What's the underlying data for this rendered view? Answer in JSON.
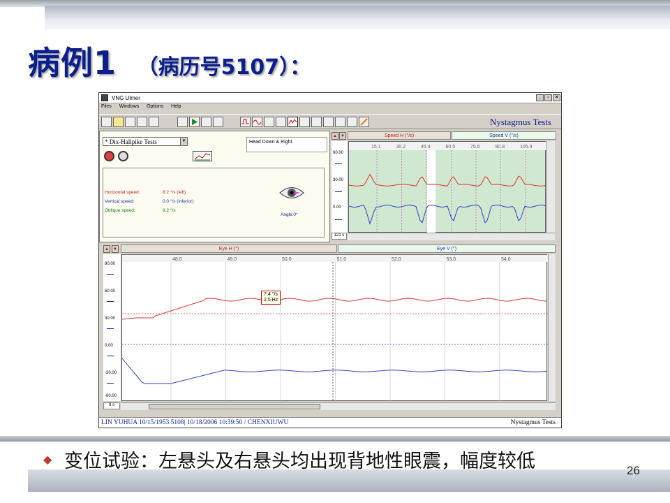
{
  "slide": {
    "title_main": "病例1",
    "title_sub": "（病历号5107）：",
    "bullet": "变位试验：左悬头及右悬头均出现背地性眼震，幅度较低",
    "page_number": "26"
  },
  "window": {
    "title": "VNG Ulmer",
    "menu": [
      "Files",
      "Windows",
      "Options",
      "Help"
    ],
    "toolbar_title": "Nystagmus Tests",
    "test_select": "* Dix-Hallpike Tests",
    "position_label": "Head Down & Right",
    "readings": {
      "horizontal_label": "Horizontal speed:",
      "horizontal_value": "8.2 °/s (left)",
      "vertical_label": "Vertical speed:",
      "vertical_value": "0.0 °/s (inferior)",
      "oblique_label": "Oblique speed:",
      "oblique_value": "8.2 °/s"
    },
    "angle_label": "Angle:0°",
    "upper_tabs": [
      "Speed H (°/s)",
      "Speed V (°/s)"
    ],
    "upper_xticks": [
      "15.1",
      "30.2",
      "45.4",
      "60.5",
      "75.6",
      "90.8",
      "105.9"
    ],
    "upper_yticks": [
      "60.00",
      "30.00",
      "0.00"
    ],
    "upper_scale": "121 s",
    "lower_tabs": [
      "Eye H (°)",
      "Eye V (°)"
    ],
    "lower_xticks": [
      "48.0",
      "49.0",
      "50.0",
      "51.0",
      "52.0",
      "53.0",
      "54.0"
    ],
    "lower_yticks": [
      "90.00",
      "60.00",
      "30.00",
      "0.00",
      "-30.00",
      "-60.00"
    ],
    "lower_scale": "8 s",
    "tooltip_line1": "7.4 °/s",
    "tooltip_line2": "2.5 Hz",
    "status_left": "LIN YUHUA  10/15/1953  5108| 10/18/2006 10:39:50  / CHENXIUWU",
    "status_right": "Nystagmus Tests"
  },
  "colors": {
    "title_blue": "#0b1f8c",
    "trace_red": "#e03030",
    "trace_blue": "#3040c8",
    "grid_green": "#c8e8c8"
  }
}
